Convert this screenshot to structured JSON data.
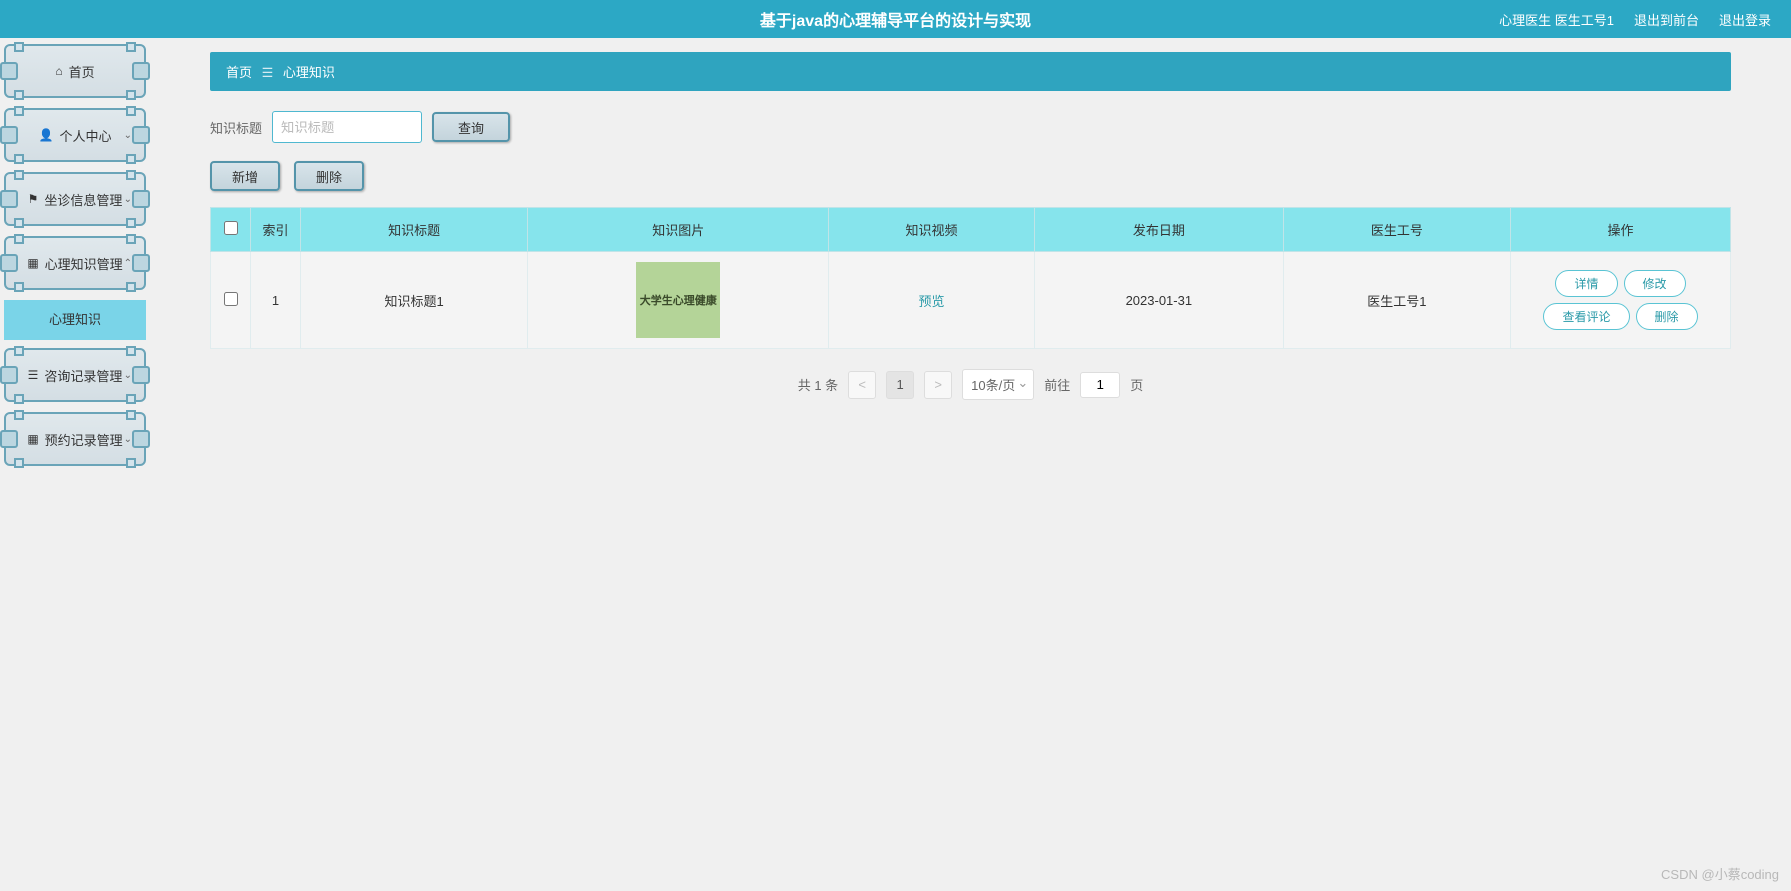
{
  "header": {
    "title": "基于java的心理辅导平台的设计与实现",
    "user_role": "心理医生 医生工号1",
    "exit_front": "退出到前台",
    "logout": "退出登录"
  },
  "sidebar": {
    "items": [
      {
        "icon": "home-icon",
        "label": "首页",
        "chevron": ""
      },
      {
        "icon": "user-icon",
        "label": "个人中心",
        "chevron": "⌄"
      },
      {
        "icon": "flag-icon",
        "label": "坐诊信息管理",
        "chevron": "⌄"
      },
      {
        "icon": "grid-icon",
        "label": "心理知识管理",
        "chevron": "⌃"
      },
      {
        "icon": "list-icon",
        "label": "咨询记录管理",
        "chevron": "⌄"
      },
      {
        "icon": "grid-icon",
        "label": "预约记录管理",
        "chevron": "⌄"
      }
    ],
    "subitem": "心理知识"
  },
  "breadcrumb": {
    "home": "首页",
    "current": "心理知识"
  },
  "filter": {
    "label": "知识标题",
    "placeholder": "知识标题",
    "search_btn": "查询"
  },
  "toolbar": {
    "add": "新增",
    "delete": "删除"
  },
  "table": {
    "headers": [
      "",
      "索引",
      "知识标题",
      "知识图片",
      "知识视频",
      "发布日期",
      "医生工号",
      "操作"
    ],
    "rows": [
      {
        "index": "1",
        "title": "知识标题1",
        "image_text": "大学生心理健康",
        "video": "预览",
        "date": "2023-01-31",
        "doctor_id": "医生工号1"
      }
    ],
    "ops": {
      "detail": "详情",
      "edit": "修改",
      "comments": "查看评论",
      "delete": "删除"
    }
  },
  "pagination": {
    "total": "共 1 条",
    "prev": "<",
    "page": "1",
    "next": ">",
    "size": "10条/页",
    "goto_label": "前往",
    "goto_value": "1",
    "goto_suffix": "页"
  },
  "watermark": "CSDN @小蔡coding"
}
